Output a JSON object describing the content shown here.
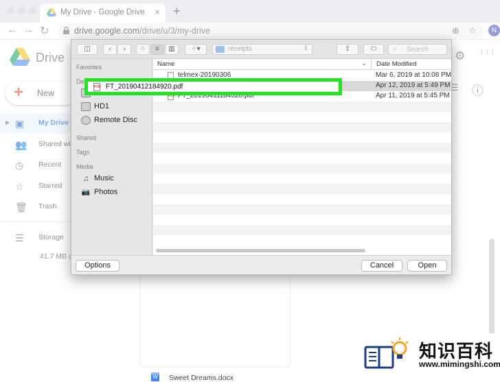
{
  "browser": {
    "tab_title": "My Drive - Google Drive",
    "tab_close": "×",
    "new_tab": "+",
    "url_host": "drive.google.com",
    "url_path": "/drive/u/3/my-drive",
    "back": "←",
    "forward": "→",
    "reload": "↻",
    "profile_initial": "N"
  },
  "drive": {
    "product_name": "Drive",
    "new_button": "New",
    "sidebar": [
      {
        "label": "My Drive",
        "icon": "my-drive-icon",
        "glyph": "▣"
      },
      {
        "label": "Shared with me",
        "icon": "people-icon",
        "glyph": "👥"
      },
      {
        "label": "Recent",
        "icon": "clock-icon",
        "glyph": "◷"
      },
      {
        "label": "Starred",
        "icon": "star-icon",
        "glyph": "☆"
      },
      {
        "label": "Trash",
        "icon": "trash-icon",
        "glyph": "🗑"
      },
      {
        "label": "Storage",
        "icon": "storage-icon",
        "glyph": "☰"
      }
    ],
    "storage_used": "41.7 MB of",
    "expander": "▶",
    "docx_badge": "W",
    "docx_name": "Sweet Dreams.docx",
    "settings_glyph": "⚙",
    "info_glyph": "ⓘ",
    "list_glyph": "☰",
    "apps_glyph": "⋮⋮⋮"
  },
  "dialog": {
    "location": "receipts",
    "search_placeholder": "Search",
    "search_glyph": "⌕",
    "sections": {
      "favorites": "Favorites",
      "devices": "Devices",
      "shared": "Shared",
      "tags": "Tags",
      "media": "Media"
    },
    "devices": [
      {
        "label": "Macintosh HD"
      },
      {
        "label": "HD1"
      },
      {
        "label": "Remote Disc"
      }
    ],
    "media": [
      {
        "label": "Music",
        "glyph": "♫"
      },
      {
        "label": "Photos",
        "glyph": "📷"
      }
    ],
    "columns": {
      "name": "Name",
      "date": "Date Modified",
      "sort_glyph": "⌄"
    },
    "files": [
      {
        "name": "telmex-20190306",
        "date": "Mar 6, 2019 at 10:08 PM"
      },
      {
        "name": "FT_20190412184920.pdf",
        "date": "Apr 12, 2019 at 5:49 PM",
        "selected": true
      },
      {
        "name": "FT_20190411184528.pdf",
        "date": "Apr 11, 2019 at 5:45 PM"
      }
    ],
    "pdf_badge": "PDF",
    "buttons": {
      "options": "Options",
      "cancel": "Cancel",
      "open": "Open"
    },
    "toolbar_glyphs": {
      "back": "‹",
      "forward": "›",
      "sidebar": "◫",
      "icons": "⁘",
      "list": "≡",
      "columns": "▥",
      "group": "⁘▾",
      "share": "⇪",
      "tag": "⬭"
    }
  },
  "watermark": {
    "text": "知识百科",
    "url": "www.mimingshi.com"
  }
}
